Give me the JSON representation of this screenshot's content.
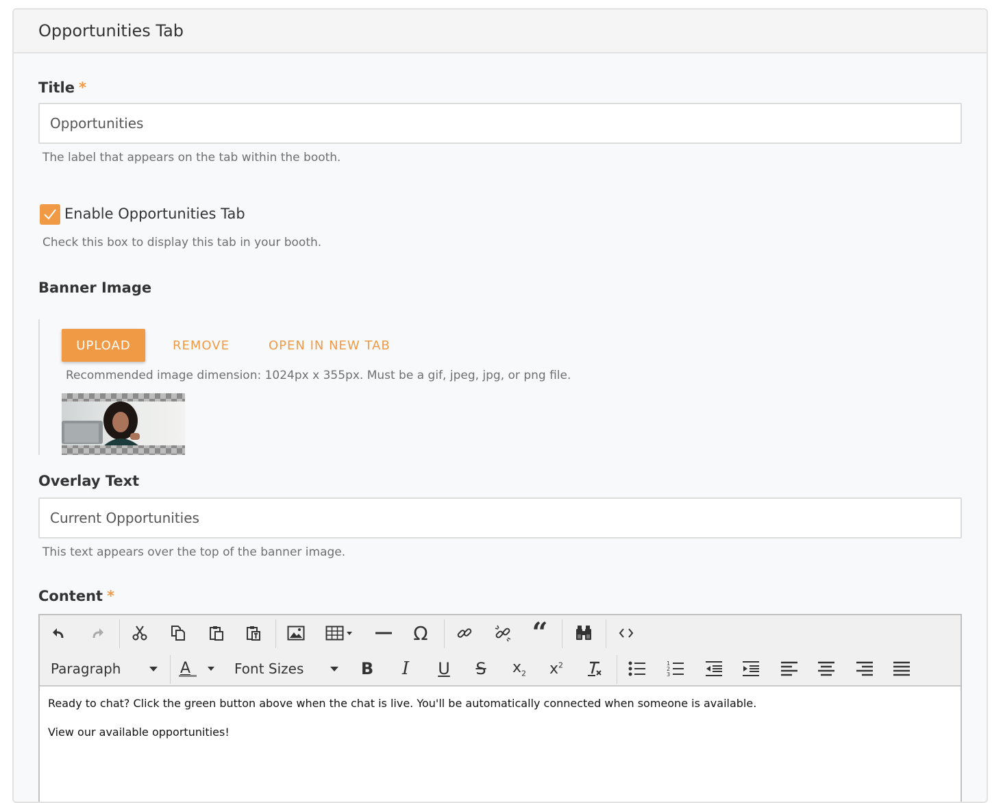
{
  "panel": {
    "title": "Opportunities Tab"
  },
  "title_field": {
    "label": "Title",
    "required_mark": "*",
    "value": "Opportunities",
    "help": "The label that appears on the tab within the booth."
  },
  "enable_tab": {
    "label": "Enable Opportunities Tab",
    "checked": true,
    "help": "Check this box to display this tab in your booth."
  },
  "banner": {
    "label": "Banner Image",
    "upload_label": "UPLOAD",
    "remove_label": "REMOVE",
    "open_label": "OPEN IN NEW TAB",
    "help": "Recommended image dimension: 1024px x 355px. Must be a gif, jpeg, jpg, or png file."
  },
  "overlay_field": {
    "label": "Overlay Text",
    "value": "Current Opportunities",
    "help": "This text appears over the top of the banner image."
  },
  "content": {
    "label": "Content",
    "required_mark": "*",
    "toolbar": {
      "format_select": "Paragraph",
      "font_sizes_select": "Font Sizes"
    },
    "paragraphs": [
      "Ready to chat? Click the green button above when the chat is live. You'll be automatically connected when someone is available.",
      "View our available opportunities!"
    ]
  },
  "colors": {
    "accent": "#f19a46",
    "panel_bg": "#f8f9fb",
    "header_bg": "#f5f5f5",
    "border": "#e2e2e2"
  }
}
